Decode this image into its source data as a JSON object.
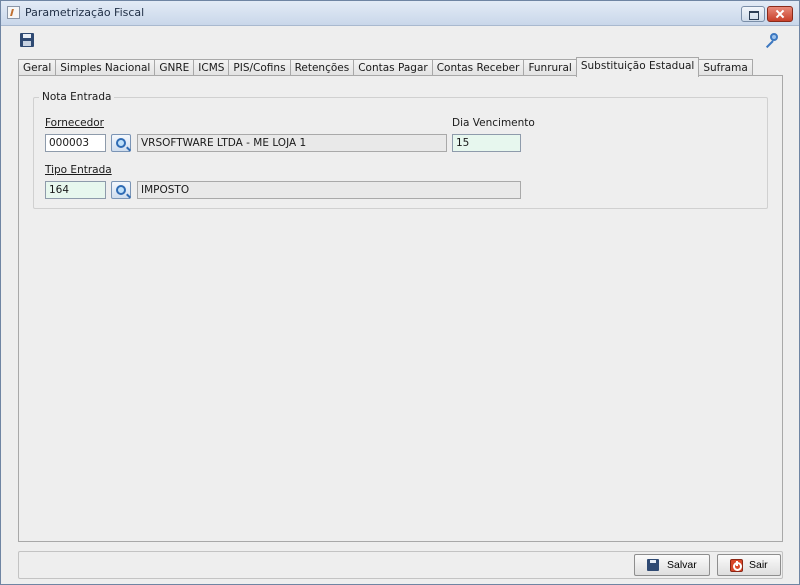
{
  "window": {
    "title": "Parametrização Fiscal"
  },
  "tabs": [
    {
      "label": "Geral"
    },
    {
      "label": "Simples Nacional"
    },
    {
      "label": "GNRE"
    },
    {
      "label": "ICMS"
    },
    {
      "label": "PIS/Cofins"
    },
    {
      "label": "Retenções"
    },
    {
      "label": "Contas Pagar"
    },
    {
      "label": "Contas Receber"
    },
    {
      "label": "Funrural"
    },
    {
      "label": "Substituição Estadual",
      "active": true
    },
    {
      "label": "Suframa"
    }
  ],
  "nota_entrada": {
    "group_title": "Nota Entrada",
    "fornecedor": {
      "label": "Fornecedor",
      "code": "000003",
      "description": "VRSOFTWARE LTDA - ME LOJA 1"
    },
    "dia_vencimento": {
      "label": "Dia Vencimento",
      "value": "15"
    },
    "tipo_entrada": {
      "label": "Tipo Entrada",
      "code": "164",
      "description": "IMPOSTO"
    }
  },
  "buttons": {
    "salvar": "Salvar",
    "sair": "Sair"
  },
  "icons": {
    "save": "floppy-disk-icon",
    "key": "key-icon",
    "lookup": "magnifier-icon",
    "exit": "exit-icon"
  }
}
